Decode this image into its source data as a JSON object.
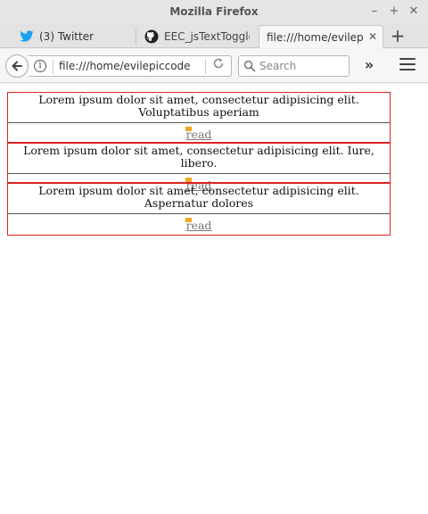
{
  "window": {
    "title": "Mozilla Firefox"
  },
  "tabs": [
    {
      "label": "(3) Twitter",
      "icon": "twitter-icon"
    },
    {
      "label": "EEC_jsTextToggle",
      "icon": "github-icon"
    },
    {
      "label": "file:///home/evilepiccode",
      "icon": "none",
      "active": true
    }
  ],
  "nav": {
    "url": "file:///home/evilepiccode",
    "search_placeholder": "Search"
  },
  "items": [
    {
      "text": "Lorem ipsum dolor sit amet, consectetur adipisicing elit. Voluptatibus aperiam",
      "link": "read"
    },
    {
      "text": "Lorem ipsum dolor sit amet, consectetur adipisicing elit. Iure, libero.",
      "link": "read"
    },
    {
      "text": "Lorem ipsum dolor sit amet, consectetur adipisicing elit. Aspernatur dolores",
      "link": "read"
    }
  ],
  "colors": {
    "box_border": "#dd2222",
    "flag": "#f5a623",
    "twitter": "#1da1f2"
  }
}
